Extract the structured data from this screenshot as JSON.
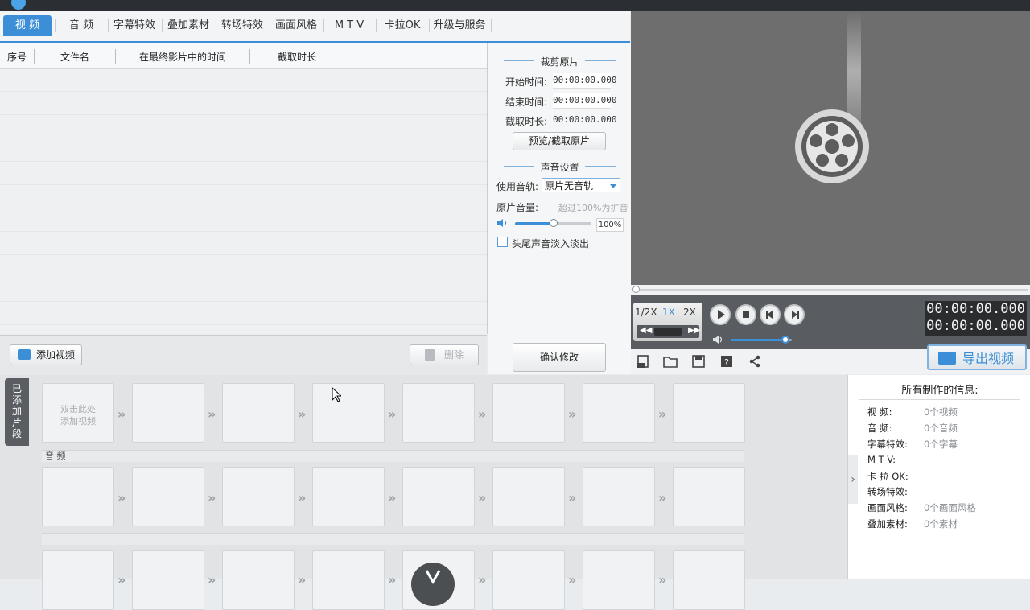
{
  "tabs": [
    {
      "label": "视 频",
      "active": true
    },
    {
      "label": "音 频"
    },
    {
      "label": "字幕特效"
    },
    {
      "label": "叠加素材"
    },
    {
      "label": "转场特效"
    },
    {
      "label": "画面风格"
    },
    {
      "label": "M T V"
    },
    {
      "label": "卡拉OK"
    },
    {
      "label": "升级与服务"
    }
  ],
  "file_list": {
    "columns": [
      "序号",
      "文件名",
      "在最终影片中的时间",
      "截取时长"
    ]
  },
  "actions": {
    "add_video": "添加视频",
    "delete": "删除",
    "confirm": "确认修改"
  },
  "trim": {
    "title": "裁剪原片",
    "start_label": "开始时间:",
    "start_value": "00:00:00.000",
    "end_label": "结束时间:",
    "end_value": "00:00:00.000",
    "duration_label": "截取时长:",
    "duration_value": "00:00:00.000",
    "preview_button": "预览/截取原片"
  },
  "audio": {
    "title": "声音设置",
    "track_label": "使用音轨:",
    "track_value": "原片无音轨",
    "volume_label": "原片音量:",
    "volume_hint": "超过100%为扩音",
    "volume_value": "100%",
    "volume_fraction": 0.5,
    "fade_label": "头尾声音淡入淡出"
  },
  "player": {
    "speeds": [
      "1/2X",
      "1X",
      "2X"
    ],
    "active_speed": "1X",
    "time_current": "00:00:00.000",
    "time_total": "00:00:00.000",
    "export_label": "导出视频",
    "volume_fraction": 0.9
  },
  "timeline": {
    "side_label": "已添加片段",
    "placeholder": "双击此处\n添加视频",
    "audio_label": "音 频"
  },
  "info": {
    "title": "所有制作的信息:",
    "rows": [
      {
        "key": "视    频:",
        "value": "0个视频"
      },
      {
        "key": "音    频:",
        "value": "0个音频"
      },
      {
        "key": "字幕特效:",
        "value": "0个字幕"
      },
      {
        "key": "M  T  V:",
        "value": ""
      },
      {
        "key": "卡 拉 OK:",
        "value": ""
      },
      {
        "key": "转场特效:",
        "value": ""
      },
      {
        "key": "画面风格:",
        "value": "0个画面风格"
      },
      {
        "key": "叠加素材:",
        "value": "0个素材"
      }
    ]
  },
  "colors": {
    "accent": "#3c8fd6",
    "preview_bg": "#6e6e6e",
    "control_bg": "#595c60"
  }
}
